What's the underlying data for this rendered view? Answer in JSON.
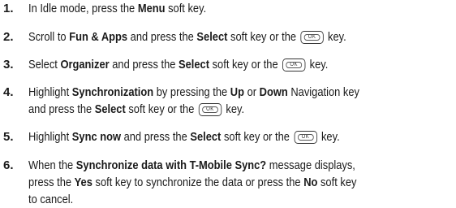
{
  "steps": [
    {
      "num": "1.",
      "lines": [
        [
          {
            "t": "In Idle mode, press the "
          },
          {
            "b": "Menu"
          },
          {
            "t": " soft key."
          }
        ]
      ]
    },
    {
      "num": "2.",
      "lines": [
        [
          {
            "t": "Scroll to "
          },
          {
            "b": "Fun & Apps"
          },
          {
            "t": " and press the "
          },
          {
            "b": "Select"
          },
          {
            "t": " soft key or the "
          },
          {
            "k": "ok"
          },
          {
            "t": " key."
          }
        ]
      ]
    },
    {
      "num": "3.",
      "lines": [
        [
          {
            "t": "Select "
          },
          {
            "b": "Organizer"
          },
          {
            "t": " and press the "
          },
          {
            "b": "Select"
          },
          {
            "t": " soft key or the "
          },
          {
            "k": "ok"
          },
          {
            "t": " key."
          }
        ]
      ]
    },
    {
      "num": "4.",
      "lines": [
        [
          {
            "t": "Highlight "
          },
          {
            "b": "Synchronization"
          },
          {
            "t": " by pressing the "
          },
          {
            "b": "Up"
          },
          {
            "t": " or "
          },
          {
            "b": "Down"
          },
          {
            "t": " Navigation key"
          }
        ],
        [
          {
            "t": "and press the "
          },
          {
            "b": "Select"
          },
          {
            "t": " soft key or the "
          },
          {
            "k": "ok"
          },
          {
            "t": " key."
          }
        ]
      ]
    },
    {
      "num": "5.",
      "lines": [
        [
          {
            "t": "Highlight "
          },
          {
            "b": "Sync now"
          },
          {
            "t": " and press the "
          },
          {
            "b": "Select"
          },
          {
            "t": " soft key or the "
          },
          {
            "k": "ok"
          },
          {
            "t": " key."
          }
        ]
      ]
    },
    {
      "num": "6.",
      "lines": [
        [
          {
            "t": "When the "
          },
          {
            "b": "Synchronize data with T-Mobile Sync?"
          },
          {
            "t": " message displays,"
          }
        ],
        [
          {
            "t": "press the "
          },
          {
            "b": "Yes"
          },
          {
            "t": " soft key to synchronize the data or press the "
          },
          {
            "b": "No"
          },
          {
            "t": " soft key"
          }
        ],
        [
          {
            "t": "to cancel."
          }
        ]
      ]
    }
  ],
  "key_icon": {
    "name": "ok-key-icon",
    "label": "OK"
  }
}
